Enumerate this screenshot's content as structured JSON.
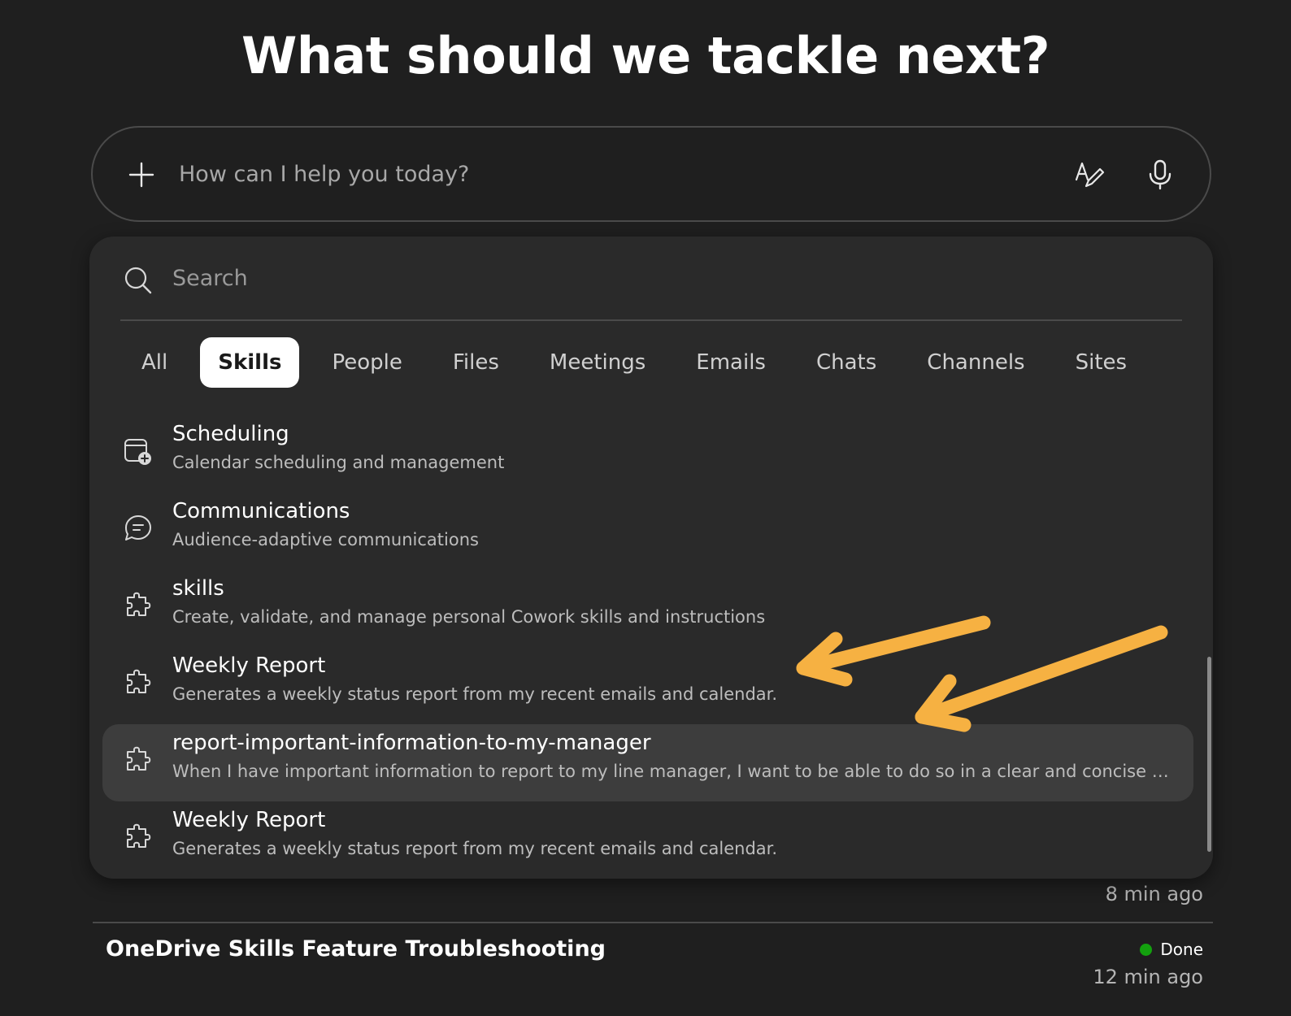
{
  "header": {
    "title": "What should we tackle next?"
  },
  "prompt": {
    "placeholder": "How can I help you today?",
    "icons": [
      "plus-icon",
      "rewrite-icon",
      "microphone-icon"
    ]
  },
  "picker": {
    "search_placeholder": "Search",
    "tabs": [
      {
        "label": "All",
        "active": false
      },
      {
        "label": "Skills",
        "active": true
      },
      {
        "label": "People",
        "active": false
      },
      {
        "label": "Files",
        "active": false
      },
      {
        "label": "Meetings",
        "active": false
      },
      {
        "label": "Emails",
        "active": false
      },
      {
        "label": "Chats",
        "active": false
      },
      {
        "label": "Channels",
        "active": false
      },
      {
        "label": "Sites",
        "active": false
      }
    ],
    "items": [
      {
        "title": "Scheduling",
        "desc": "Calendar scheduling and management",
        "icon": "calendar-add-icon"
      },
      {
        "title": "Communications",
        "desc": "Audience-adaptive communications",
        "icon": "chat-bubble-icon"
      },
      {
        "title": "skills",
        "desc": "Create, validate, and manage personal Cowork skills and instructions",
        "icon": "puzzle-icon"
      },
      {
        "title": "Weekly Report",
        "desc": "Generates a weekly status report from my recent emails and calendar.",
        "icon": "puzzle-icon"
      },
      {
        "title": "report-important-information-to-my-manager",
        "desc": "When I have important information to report to my line manager, I want to be able to do so in a clear and concise m...",
        "icon": "puzzle-icon",
        "highlighted": true
      },
      {
        "title": "Weekly Report",
        "desc": "Generates a weekly status report from my recent emails and calendar.",
        "icon": "puzzle-icon"
      }
    ]
  },
  "recent": [
    {
      "title": "",
      "time": "8 min ago"
    },
    {
      "title": "OneDrive Skills Feature Troubleshooting",
      "status": "Done",
      "time": "12 min ago"
    }
  ],
  "colors": {
    "background": "#1f1f1f",
    "panel": "#2a2a2a",
    "highlight_row": "#3d3d3d",
    "annotation_arrow": "#f6b142",
    "status_done": "#13a10e"
  }
}
